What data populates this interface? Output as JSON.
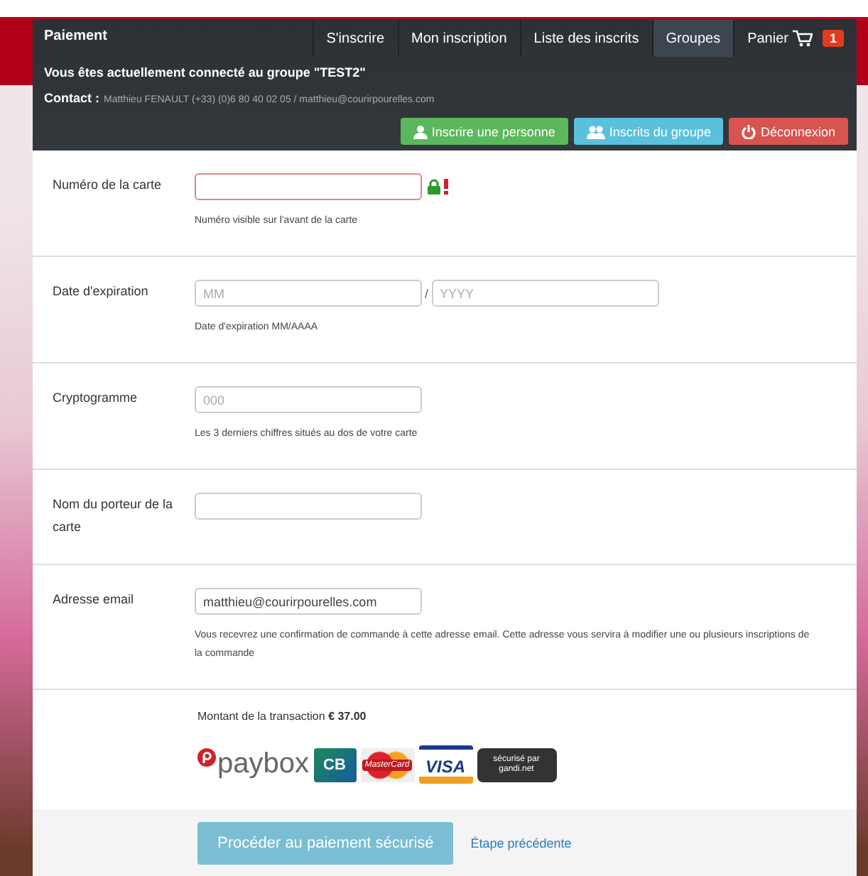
{
  "header": {
    "brand": "Paiement",
    "nav": [
      {
        "label": "S'inscrire",
        "selected": false
      },
      {
        "label": "Mon inscription",
        "selected": false
      },
      {
        "label": "Liste des inscrits",
        "selected": false
      },
      {
        "label": "Groupes",
        "selected": true
      }
    ],
    "cart": {
      "label": "Panier",
      "badge": "1"
    },
    "group_notice": "Vous êtes actuellement connecté au groupe \"TEST2\"",
    "contact_label": "Contact :",
    "contact_value": "Matthieu FENAULT (+33) (0)6 80 40 02 05 / matthieu@courirpourelles.com",
    "buttons": [
      {
        "kind": "person",
        "label": "Inscrire une personne"
      },
      {
        "kind": "group",
        "label": "Inscrits du groupe"
      },
      {
        "kind": "logout",
        "label": "Déconnexion"
      }
    ]
  },
  "fields": [
    {
      "label": "Numéro de la carte",
      "inputs": [
        {
          "invalid": true
        }
      ],
      "secure": true,
      "help": "Numéro visible sur l'avant de la carte"
    },
    {
      "label": "Date d'expiration",
      "inputs": [
        {
          "placeholder": "MM",
          "invalid": false
        },
        {
          "placeholder": "YYYY",
          "invalid": false
        }
      ],
      "separator": "/",
      "help": "Date d'expiration MM/AAAA"
    },
    {
      "label": "Cryptogramme",
      "inputs": [
        {
          "placeholder": "000",
          "invalid": false
        }
      ],
      "help": "Les 3 derniers chiffres situés au dos de votre carte"
    },
    {
      "label": "Nom du porteur de la carte",
      "inputs": [
        {
          "invalid": false
        }
      ]
    },
    {
      "label": "Adresse email",
      "inputs": [
        {
          "value": "matthieu@courirpourelles.com",
          "invalid": false
        }
      ],
      "help": "Vous recevrez une confirmation de commande à cette adresse email. Cette adresse vous servira à modifier une ou plusieurs inscriptions de la commande"
    }
  ],
  "amount": "Montant de la transaction **€ 37.00**",
  "logos": [
    {
      "kind": "paybox",
      "label": "paybox"
    },
    {
      "kind": "cb",
      "label": "CB"
    },
    {
      "kind": "mastercard",
      "label": "MasterCard"
    },
    {
      "kind": "visa",
      "label": "VISA"
    },
    {
      "kind": "gandi",
      "label": "sécurisé par gandi.net"
    }
  ],
  "submit": "Procéder au paiement sécurisé",
  "back": "Étape précédente"
}
